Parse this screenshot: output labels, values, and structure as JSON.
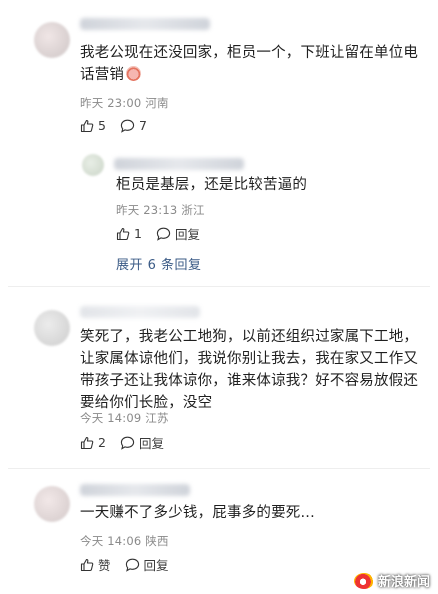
{
  "comments": [
    {
      "text": "我老公现在还没回家，柜员一个，下班让留在单位电话营销",
      "time": "昨天 23:00",
      "location": "河南",
      "likes": "5",
      "replies": "7"
    },
    {
      "text": "笑死了，我老公工地狗，以前还组织过家属下工地，让家属体谅他们，我说你别让我去，我在家又工作又带孩子还让我体谅你，谁来体谅我？好不容易放假还要给你们长脸，没空",
      "time": "今天 14:09",
      "location": "江苏",
      "likes": "2",
      "reply_label": "回复"
    },
    {
      "text": "一天赚不了多少钱，屁事多的要死...",
      "time": "今天 14:06",
      "location": "陕西",
      "like_label": "赞",
      "reply_label": "回复"
    }
  ],
  "reply": {
    "text": "柜员是基层，还是比较苦逼的",
    "time": "昨天 23:13",
    "location": "浙江",
    "likes": "1",
    "reply_label": "回复"
  },
  "expand_label": "展开 6 条回复",
  "watermark": "新浪新闻",
  "colors": {
    "link": "#3b5b86",
    "meta": "#8a8a8a",
    "text": "#1f1f1f"
  }
}
